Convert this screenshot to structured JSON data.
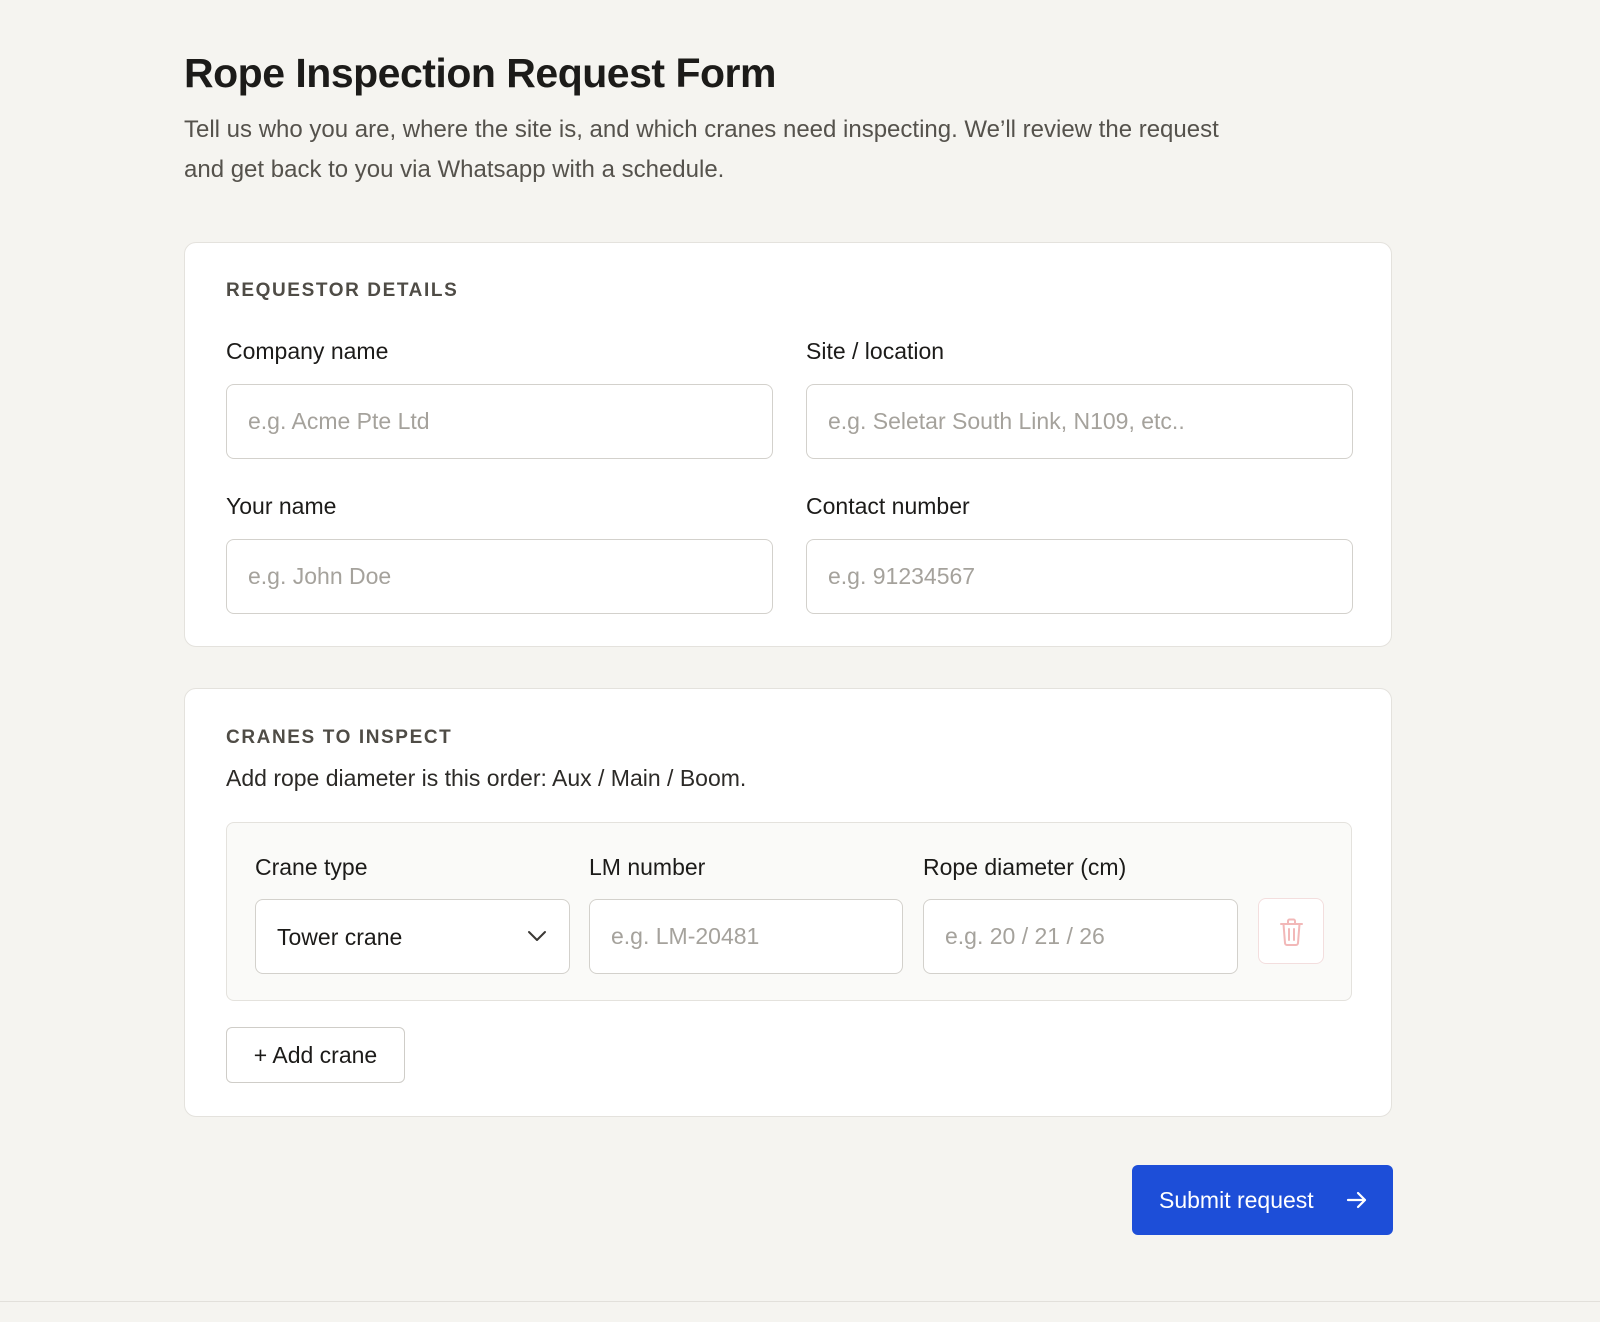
{
  "header": {
    "title": "Rope Inspection Request Form",
    "subtitle": "Tell us who you are, where the site is, and which cranes need inspecting. We’ll review the request and get back to you via Whatsapp with a schedule."
  },
  "requestor": {
    "heading": "REQUESTOR DETAILS",
    "company": {
      "label": "Company name",
      "value": "",
      "placeholder": "e.g. Acme Pte Ltd"
    },
    "site": {
      "label": "Site / location",
      "value": "",
      "placeholder": "e.g. Seletar South Link, N109, etc.."
    },
    "name": {
      "label": "Your name",
      "value": "",
      "placeholder": "e.g. John Doe"
    },
    "contact": {
      "label": "Contact number",
      "value": "",
      "placeholder": "e.g. 91234567"
    }
  },
  "cranes": {
    "heading": "CRANES TO INSPECT",
    "helper": "Add rope diameter is this order: Aux / Main / Boom.",
    "rows": [
      {
        "type_label": "Crane type",
        "type_value": "Tower crane",
        "lm_label": "LM number",
        "lm_value": "",
        "lm_placeholder": "e.g. LM-20481",
        "rope_label": "Rope diameter (cm)",
        "rope_value": "",
        "rope_placeholder": "e.g. 20 / 21 / 26",
        "delete_icon": "trash-icon"
      }
    ],
    "add_label": "+ Add crane"
  },
  "actions": {
    "submit_label": "Submit request",
    "submit_icon": "arrow-right-icon"
  },
  "colors": {
    "background": "#f5f4f0",
    "card": "#ffffff",
    "accent": "#1d4ed8",
    "delete_accent": "#f2b8b8"
  }
}
